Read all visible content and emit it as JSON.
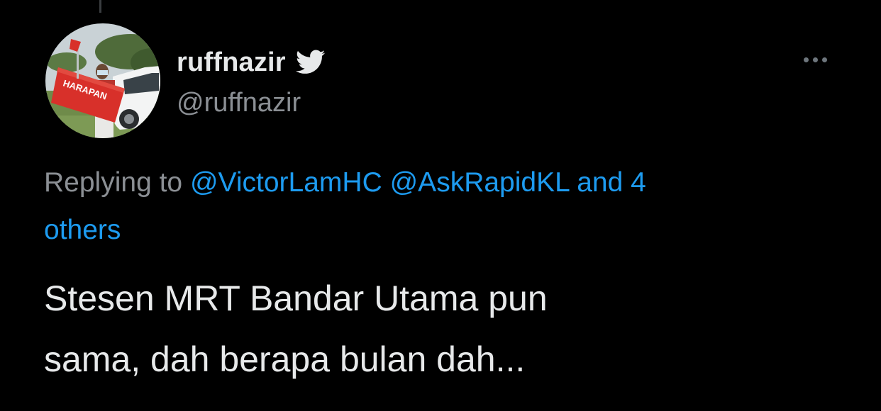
{
  "colors": {
    "background": "#000000",
    "text_primary": "#e7e9ea",
    "text_secondary": "#8b8f94",
    "accent": "#1d9bf0"
  },
  "author": {
    "display_name": "ruffnazir",
    "handle": "@ruffnazir",
    "avatar_icon": "profile-photo-harapan-flag",
    "avatar_flag_text": "HARAPAN",
    "badge_icon": "twitter-bird-icon"
  },
  "menu": {
    "more_icon": "more-options-ellipsis-icon"
  },
  "reply": {
    "prefix": "Replying to",
    "mentions": [
      "@VictorLamHC",
      "@AskRapidKL"
    ],
    "joiner": "and 4",
    "others": "others"
  },
  "tweet": {
    "line1": "Stesen MRT Bandar Utama pun",
    "line2": "sama, dah berapa bulan dah..."
  }
}
